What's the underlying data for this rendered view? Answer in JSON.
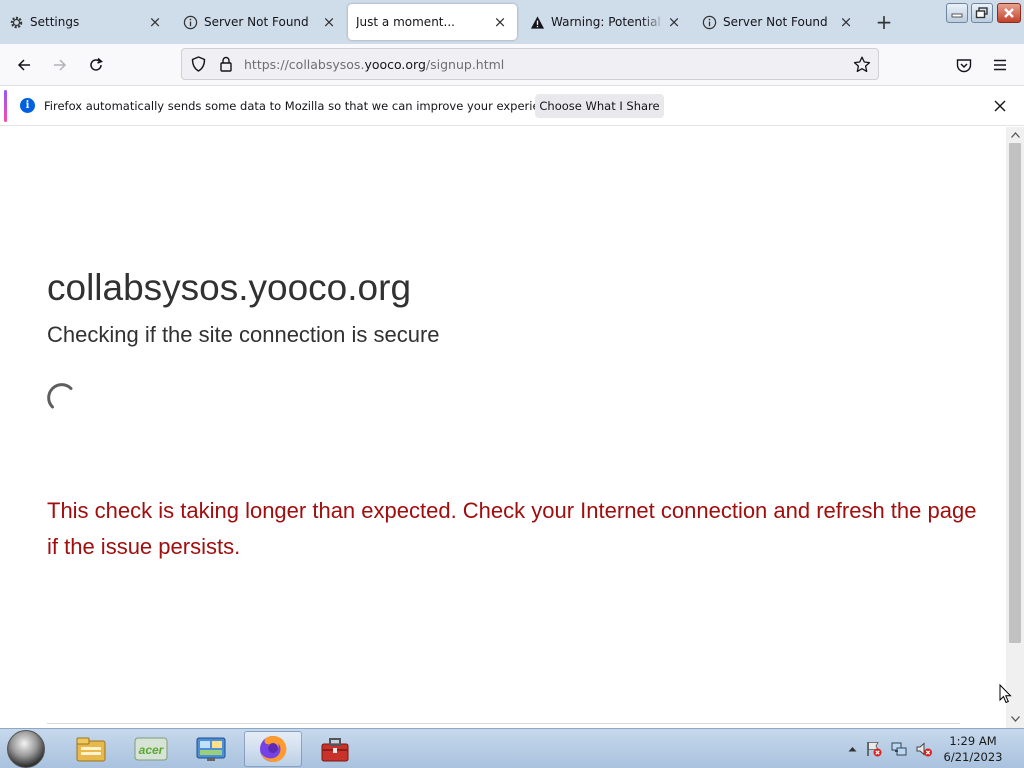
{
  "tabs": [
    {
      "title": "Settings",
      "icon": "gear-icon",
      "active": false
    },
    {
      "title": "Server Not Found",
      "icon": "info-icon",
      "active": false
    },
    {
      "title": "Just a moment...",
      "icon": "none",
      "active": true
    },
    {
      "title": "Warning: Potential Security Risk Ahead",
      "icon": "warning-icon",
      "active": false
    },
    {
      "title": "Server Not Found",
      "icon": "info-icon",
      "active": false
    }
  ],
  "url": {
    "prefix": "https://collabsysos.",
    "domain": "yooco.org",
    "path": "/signup.html"
  },
  "notification": {
    "message": "Firefox automatically sends some data to Mozilla so that we can improve your experience.",
    "button": "Choose What I Share"
  },
  "page": {
    "site": "collabsysos.yooco.org",
    "subtitle": "Checking if the site connection is secure",
    "warning": "This check is taking longer than expected. Check your Internet connection and refresh the page if the issue persists."
  },
  "clock": {
    "time": "1:29 AM",
    "date": "6/21/2023"
  },
  "colors": {
    "warning_text": "#a00e0e",
    "accent": "#0061e0"
  }
}
